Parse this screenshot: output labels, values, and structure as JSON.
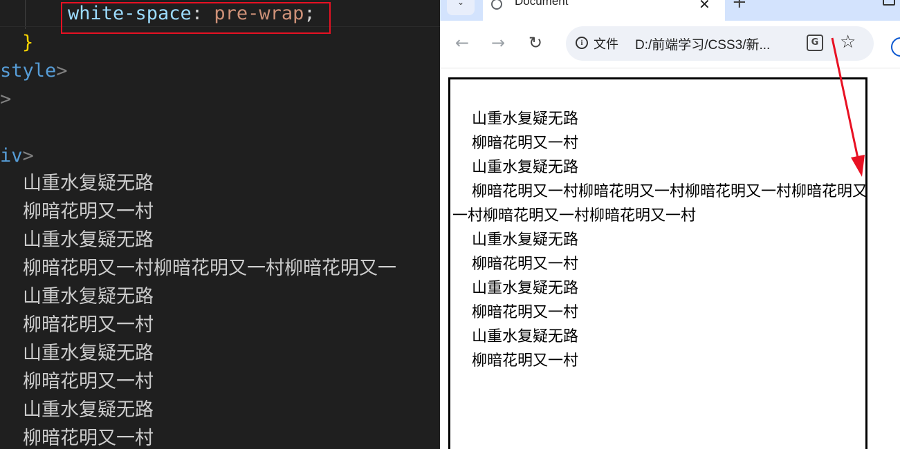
{
  "editor": {
    "code": {
      "prop": "white-space",
      "colon": ":",
      "value": "pre-wrap",
      "semi": ";",
      "close_brace": "}",
      "style_close": "style",
      "angle_close": ">",
      "div_close": "iv"
    },
    "text_lines": [
      "山重水复疑无路",
      "柳暗花明又一村",
      "山重水复疑无路",
      "柳暗花明又一村柳暗花明又一村柳暗花明又一",
      "山重水复疑无路",
      "柳暗花明又一村",
      "山重水复疑无路",
      "柳暗花明又一村",
      "山重水复疑无路",
      "柳暗花明又一村"
    ]
  },
  "browser": {
    "tab_title": "Document",
    "close_glyph": "✕",
    "new_tab_glyph": "+",
    "back_glyph": "←",
    "forward_glyph": "→",
    "reload_glyph": "↻",
    "chip_label": "文件",
    "url": "D:/前端学习/CSS3/新...",
    "star_glyph": "☆",
    "page_text": "    山重水复疑无路\n    柳暗花明又一村\n    山重水复疑无路\n    柳暗花明又一村柳暗花明又一村柳暗花明又一村柳暗花明又一村柳暗花明又一村柳暗花明又一村\n    山重水复疑无路\n    柳暗花明又一村\n    山重水复疑无路\n    柳暗花明又一村\n    山重水复疑无路\n    柳暗花明又一村"
  },
  "icons": {
    "tab_favicon": "globe-icon",
    "info": "info-icon",
    "translate": "translate-icon",
    "bookmark": "star-icon",
    "profile": "profile-icon"
  },
  "colors": {
    "editor_bg": "#1f1f1f",
    "highlight_box": "#e81123",
    "annotation_arrow": "#e81123",
    "tabstrip": "#d3e3fd"
  }
}
